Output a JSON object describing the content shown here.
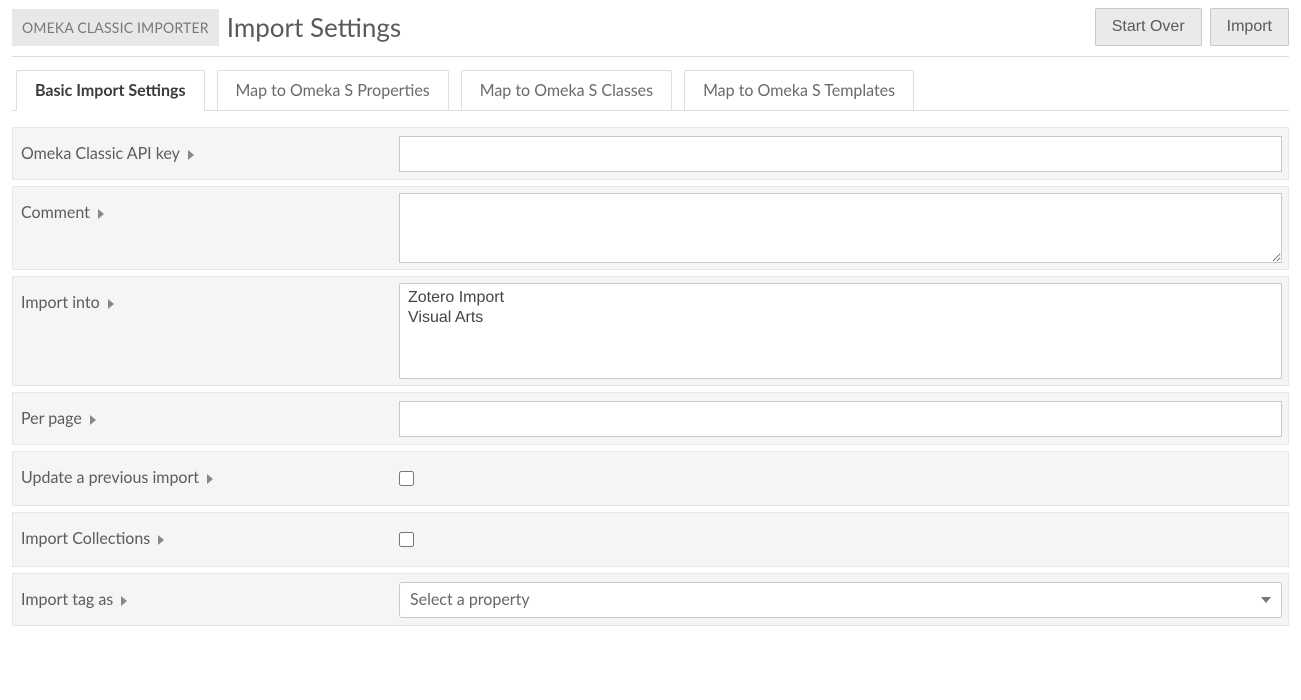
{
  "header": {
    "badge": "OMEKA CLASSIC IMPORTER",
    "title": "Import Settings",
    "start_over": "Start Over",
    "import": "Import"
  },
  "tabs": [
    {
      "label": "Basic Import Settings",
      "active": true
    },
    {
      "label": "Map to Omeka S Properties",
      "active": false
    },
    {
      "label": "Map to Omeka S Classes",
      "active": false
    },
    {
      "label": "Map to Omeka S Templates",
      "active": false
    }
  ],
  "fields": {
    "api_key": {
      "label": "Omeka Classic API key",
      "value": ""
    },
    "comment": {
      "label": "Comment",
      "value": ""
    },
    "import_into": {
      "label": "Import into",
      "options": [
        "Zotero Import",
        "Visual Arts"
      ]
    },
    "per_page": {
      "label": "Per page",
      "value": ""
    },
    "update_prev": {
      "label": "Update a previous import",
      "checked": false
    },
    "import_colls": {
      "label": "Import Collections",
      "checked": false
    },
    "import_tag_as": {
      "label": "Import tag as",
      "placeholder": "Select a property"
    }
  }
}
